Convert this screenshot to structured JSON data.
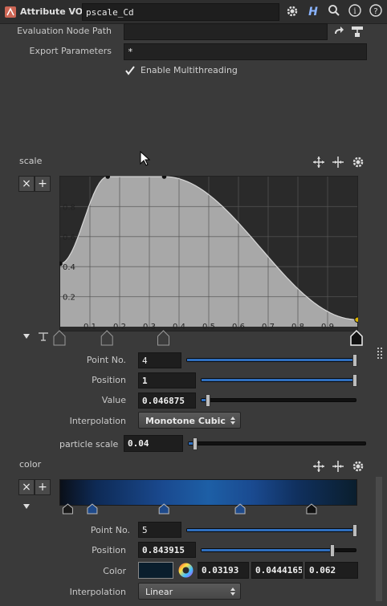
{
  "header": {
    "node_type": "Attribute VOP",
    "node_name": "pscale_Cd",
    "icons": [
      "gear-icon",
      "houdini-help-icon",
      "search-icon",
      "info-icon",
      "help-icon"
    ]
  },
  "params": {
    "eval_node_path_label": "Evaluation Node Path",
    "eval_node_path_value": "",
    "export_params_label": "Export Parameters",
    "export_params_value": "*",
    "multithreading_label": "Enable Multithreading",
    "multithreading_checked": true
  },
  "scale_ramp": {
    "title": "scale",
    "point_no_label": "Point No.",
    "point_no": "4",
    "position_label": "Position",
    "position": "1",
    "value_label": "Value",
    "value": "0.046875",
    "interp_label": "Interpolation",
    "interp": "Monotone Cubic"
  },
  "particle_scale": {
    "label": "particle scale",
    "value": "0.04"
  },
  "color_ramp": {
    "title": "color",
    "point_no_label": "Point No.",
    "point_no": "5",
    "position_label": "Position",
    "position": "0.843915",
    "color_label": "Color",
    "r": "0.03193",
    "g": "0.0444165",
    "b": "0.062",
    "interp_label": "Interpolation",
    "interp": "Linear",
    "swatch": "#0a1e2d"
  },
  "chart_data": {
    "type": "area",
    "title": "scale",
    "x_ticks": [
      "0.1",
      "0.2",
      "0.3",
      "0.4",
      "0.5",
      "0.6",
      "0.7",
      "0.8",
      "0.9"
    ],
    "y_ticks": [
      "0.2",
      "0.4",
      "0.6",
      "0.8"
    ],
    "xlim": [
      0,
      1
    ],
    "ylim": [
      0,
      1
    ],
    "points": [
      {
        "x": 0.0,
        "y": 0.42
      },
      {
        "x": 0.16,
        "y": 1.0
      },
      {
        "x": 0.35,
        "y": 1.0
      },
      {
        "x": 1.0,
        "y": 0.046875
      }
    ],
    "grid": true
  },
  "colors": {
    "accent": "#2f6fbf",
    "curve_fill": "#a8a8a8",
    "plot_bg": "#2a2a2a"
  }
}
